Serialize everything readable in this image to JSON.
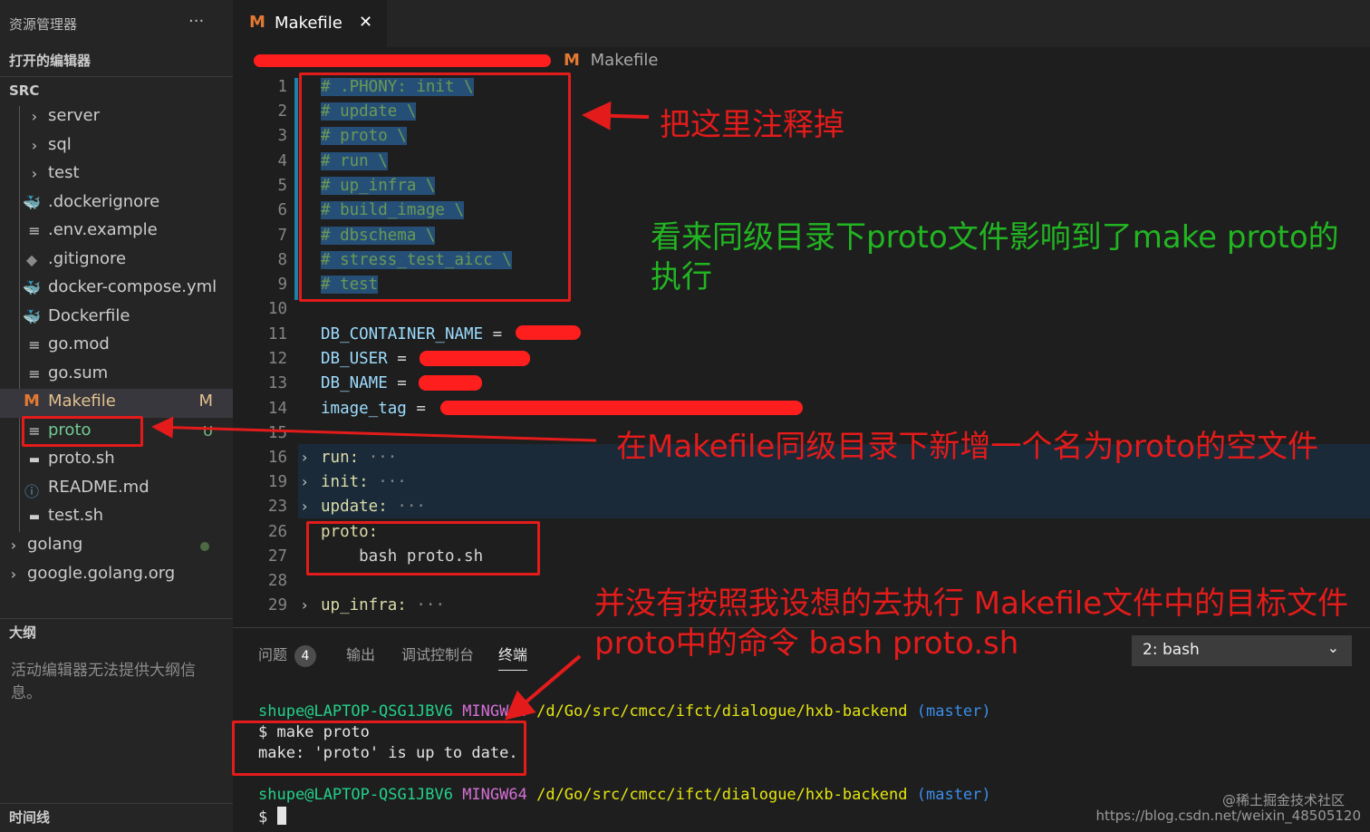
{
  "sidebar": {
    "explorer_title": "资源管理器",
    "more_label": "···",
    "open_editors": "打开的编辑器",
    "folder": "SRC",
    "items": [
      {
        "label": "server",
        "icon": "chevron-right"
      },
      {
        "label": "sql",
        "icon": "chevron-right"
      },
      {
        "label": "test",
        "icon": "chevron-right"
      },
      {
        "label": ".dockerignore",
        "icon": "docker-icon"
      },
      {
        "label": ".env.example",
        "icon": "lines-icon"
      },
      {
        "label": ".gitignore",
        "icon": "git-icon"
      },
      {
        "label": "docker-compose.yml",
        "icon": "docker-icon"
      },
      {
        "label": "Dockerfile",
        "icon": "docker-icon"
      },
      {
        "label": "go.mod",
        "icon": "lines-icon"
      },
      {
        "label": "go.sum",
        "icon": "lines-icon"
      },
      {
        "label": "Makefile",
        "icon": "makefile-icon",
        "badge": "M"
      },
      {
        "label": "proto",
        "icon": "lines-icon",
        "badge": "U"
      },
      {
        "label": "proto.sh",
        "icon": "shell-icon"
      },
      {
        "label": "README.md",
        "icon": "info-icon"
      },
      {
        "label": "test.sh",
        "icon": "shell-icon"
      }
    ],
    "folders": [
      {
        "label": "golang"
      },
      {
        "label": "google.golang.org"
      }
    ],
    "outline_title": "大纲",
    "outline_message": "活动编辑器无法提供大纲信息。",
    "timeline_title": "时间线"
  },
  "tab": {
    "icon": "M",
    "label": "Makefile",
    "close": "✕"
  },
  "breadcrumb": {
    "icon": "M",
    "file": "Makefile"
  },
  "code_lines": [
    {
      "n": "1",
      "text": "# .PHONY: init \\"
    },
    {
      "n": "2",
      "text": "# update \\"
    },
    {
      "n": "3",
      "text": "# proto \\"
    },
    {
      "n": "4",
      "text": "# run \\"
    },
    {
      "n": "5",
      "text": "# up_infra \\"
    },
    {
      "n": "6",
      "text": "# build_image \\"
    },
    {
      "n": "7",
      "text": "# dbschema \\"
    },
    {
      "n": "8",
      "text": "# stress_test_aicc \\"
    },
    {
      "n": "9",
      "text": "# test"
    },
    {
      "n": "10",
      "text": ""
    },
    {
      "n": "11",
      "key": "DB_CONTAINER_NAME",
      "op": " = "
    },
    {
      "n": "12",
      "key": "DB_USER",
      "op": " = "
    },
    {
      "n": "13",
      "key": "DB_NAME",
      "op": " = "
    },
    {
      "n": "14",
      "key": "image_tag",
      "op": " = "
    },
    {
      "n": "15",
      "text": ""
    },
    {
      "n": "16",
      "target": "run:",
      "folded": "···"
    },
    {
      "n": "19",
      "target": "init:",
      "folded": "···"
    },
    {
      "n": "23",
      "target": "update:",
      "folded": "···"
    },
    {
      "n": "26",
      "target": "proto:"
    },
    {
      "n": "27",
      "text": "    bash proto.sh"
    },
    {
      "n": "28",
      "text": ""
    },
    {
      "n": "29",
      "target": "up_infra:",
      "folded": "···"
    }
  ],
  "panel": {
    "tabs": [
      "问题",
      "输出",
      "调试控制台",
      "终端"
    ],
    "problems_count": "4",
    "terminal_select": "2: bash",
    "terminal": {
      "user": "shupe@LAPTOP-QSG1JBV6",
      "env": "MINGW64",
      "path": "/d/Go/src/cmcc/ifct/dialogue/hxb-backend",
      "branch": "(master)",
      "cmd": "$ make proto",
      "output": "make: 'proto' is up to date.",
      "prompt": "$"
    }
  },
  "annotations": {
    "comment_out": "把这里注释掉",
    "green_note": "看来同级目录下proto文件影响到了make proto的执行",
    "new_file": "在Makefile同级目录下新增一个名为proto的空文件",
    "not_executed": "并没有按照我设想的去执行 Makefile文件中的目标文件proto中的命令 bash proto.sh"
  },
  "watermark": {
    "line1": "@稀土掘金技术社区",
    "line2": "https://blog.csdn.net/weixin_48505120"
  },
  "colors": {
    "annotation_red": "#e31b1b",
    "annotation_green": "#22b522",
    "makefile_icon": "#e37933",
    "modified_badge": "#e2c08d"
  }
}
